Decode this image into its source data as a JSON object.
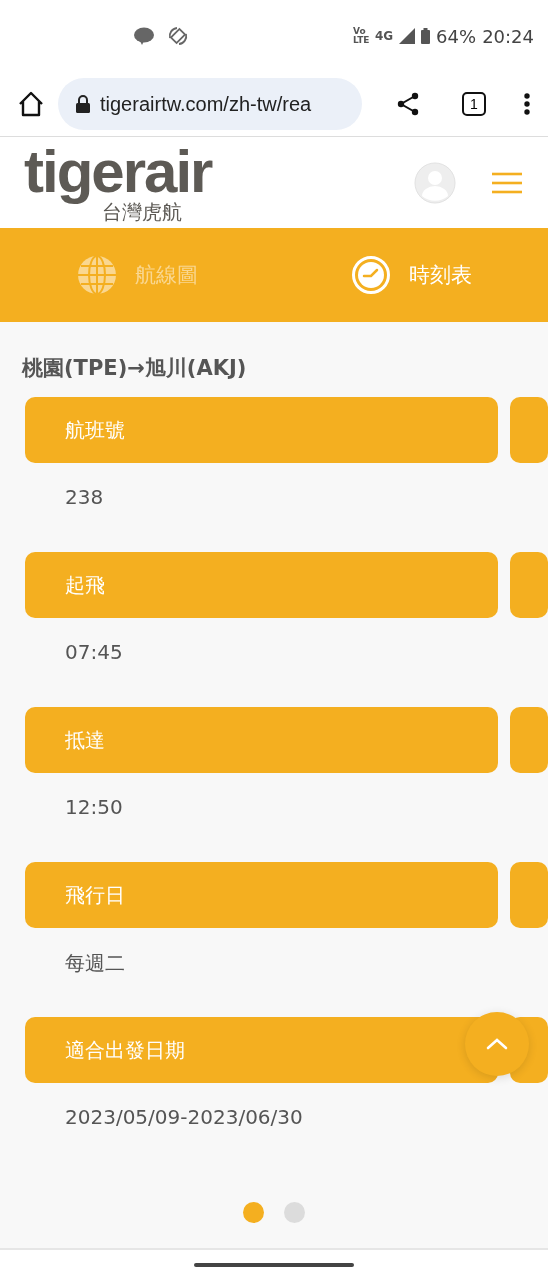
{
  "status_bar": {
    "battery": "64%",
    "time": "20:24",
    "network": "4G",
    "volte": "Vo LTE"
  },
  "browser": {
    "url": "tigerairtw.com/zh-tw/rea",
    "tab_count": "1"
  },
  "header": {
    "logo": "tigerair",
    "logo_subtitle": "台灣虎航"
  },
  "tabs": [
    {
      "label": "航線圖",
      "kind": "globe",
      "selected": false
    },
    {
      "label": "時刻表",
      "kind": "clock",
      "selected": true
    }
  ],
  "route": "桃園(TPE)→旭川(AKJ)",
  "fields": [
    {
      "label": "航班號",
      "value": "238"
    },
    {
      "label": "起飛",
      "value": "07:45"
    },
    {
      "label": "抵達",
      "value": "12:50"
    },
    {
      "label": "飛行日",
      "value": "每週二"
    },
    {
      "label": "適合出發日期",
      "value": "2023/05/09-2023/06/30"
    }
  ],
  "pager": [
    {
      "selected": true
    },
    {
      "selected": false
    }
  ]
}
